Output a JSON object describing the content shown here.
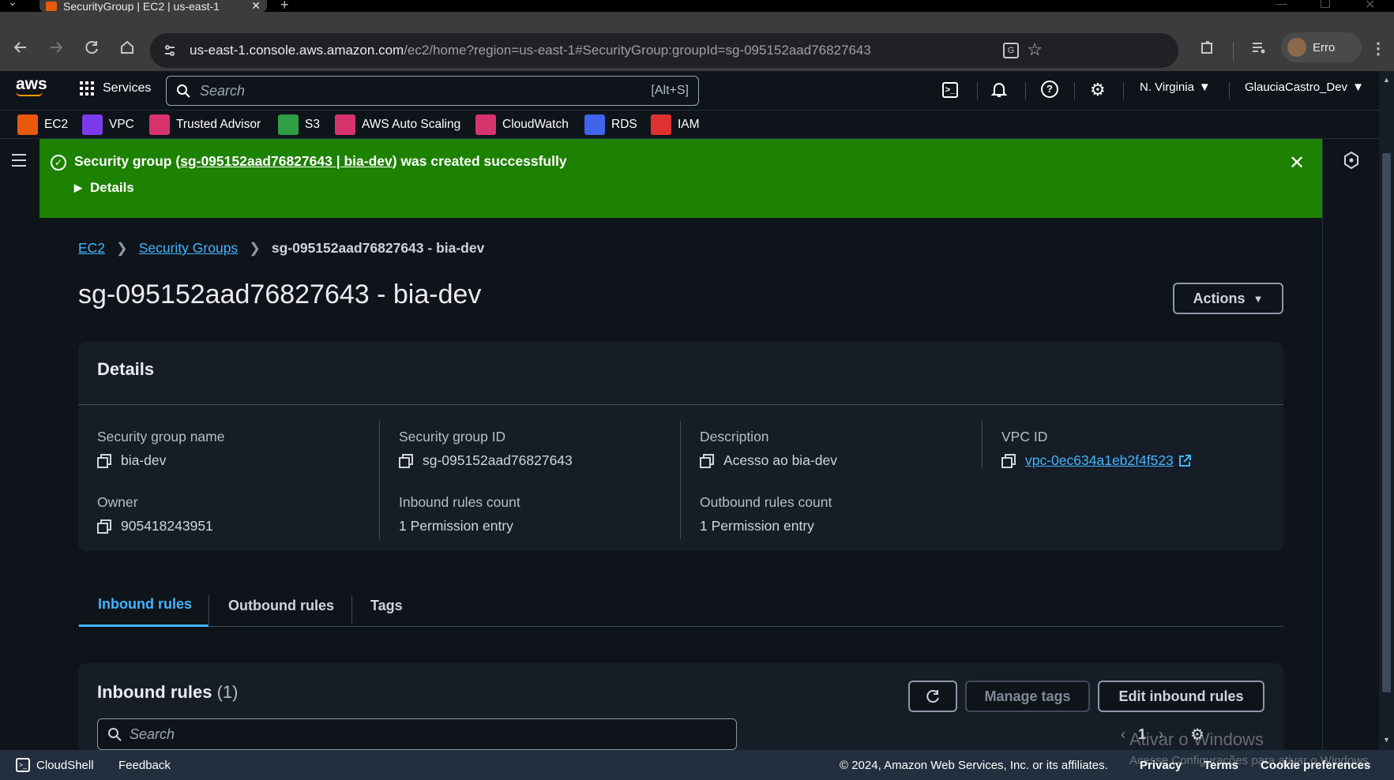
{
  "browser": {
    "tab_title": "SecurityGroup | EC2 | us-east-1",
    "url_host": "us-east-1.console.aws.amazon.com",
    "url_path": "/ec2/home?region=us-east-1#SecurityGroup:groupId=sg-095152aad76827643",
    "profile_label": "Erro"
  },
  "aws_nav": {
    "logo": "aws",
    "services_label": "Services",
    "search_placeholder": "Search",
    "search_shortcut": "[Alt+S]",
    "region": "N. Virginia",
    "account": "GlauciaCastro_Dev"
  },
  "favorites": [
    {
      "label": "EC2",
      "color": "#e8590c"
    },
    {
      "label": "VPC",
      "color": "#7c3aed"
    },
    {
      "label": "Trusted Advisor",
      "color": "#d6336c"
    },
    {
      "label": "S3",
      "color": "#2f9e44"
    },
    {
      "label": "AWS Auto Scaling",
      "color": "#d6336c"
    },
    {
      "label": "CloudWatch",
      "color": "#d6336c"
    },
    {
      "label": "RDS",
      "color": "#4263eb"
    },
    {
      "label": "IAM",
      "color": "#e03131"
    }
  ],
  "flash": {
    "prefix": "Security group (",
    "link": "sg-095152aad76827643 | bia-dev",
    "suffix": ") was created successfully",
    "details_label": "Details"
  },
  "breadcrumb": {
    "root": "EC2",
    "section": "Security Groups",
    "current": "sg-095152aad76827643 - bia-dev"
  },
  "page_title": "sg-095152aad76827643 - bia-dev",
  "actions_label": "Actions",
  "details": {
    "heading": "Details",
    "sg_name_label": "Security group name",
    "sg_name": "bia-dev",
    "sg_id_label": "Security group ID",
    "sg_id": "sg-095152aad76827643",
    "description_label": "Description",
    "description": "Acesso ao bia-dev",
    "vpc_label": "VPC ID",
    "vpc_id": "vpc-0ec634a1eb2f4f523",
    "owner_label": "Owner",
    "owner": "905418243951",
    "inbound_label": "Inbound rules count",
    "inbound": "1 Permission entry",
    "outbound_label": "Outbound rules count",
    "outbound": "1 Permission entry"
  },
  "tabs": [
    "Inbound rules",
    "Outbound rules",
    "Tags"
  ],
  "inbound_panel": {
    "title": "Inbound rules",
    "count": "(1)",
    "manage_tags_label": "Manage tags",
    "edit_label": "Edit inbound rules",
    "search_placeholder": "Search",
    "page_number": "1"
  },
  "footer": {
    "cloudshell": "CloudShell",
    "feedback": "Feedback",
    "copyright": "© 2024, Amazon Web Services, Inc. or its affiliates.",
    "privacy": "Privacy",
    "terms": "Terms",
    "cookies": "Cookie preferences"
  },
  "watermark": {
    "line1": "Ativar o Windows",
    "line2": "Acesse Configurações para ativar o Windows."
  }
}
